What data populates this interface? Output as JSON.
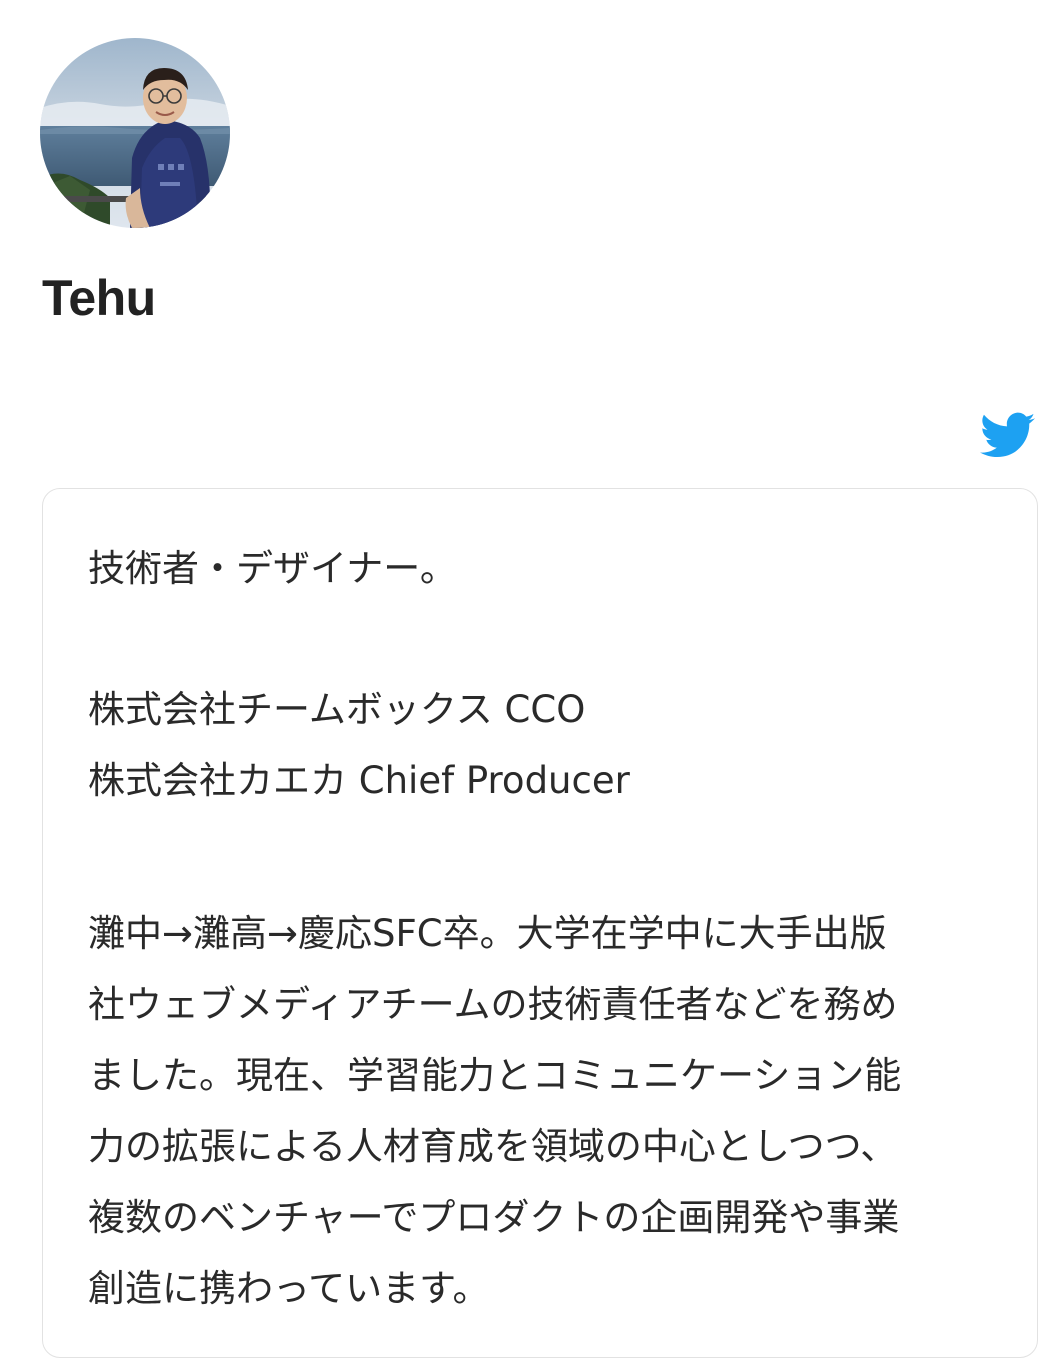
{
  "profile": {
    "name": "Tehu",
    "avatar_alt": "profile photo"
  },
  "social": {
    "twitter_icon": "twitter-bird-icon",
    "twitter_color": "#1DA1F2"
  },
  "bio": {
    "line1": "技術者・デザイナー。",
    "roles": [
      "株式会社チームボックス CCO",
      "株式会社カエカ Chief Producer"
    ],
    "history": [
      "灘中→灘高→慶応SFC卒。大学在学中に大手出版",
      "社ウェブメディアチームの技術責任者などを務め",
      "ました。現在、学習能力とコミュニケーション能",
      "力の拡張による人材育成を領域の中心としつつ、",
      "複数のベンチャーでプロダクトの企画開発や事業",
      "創造に携わっています。"
    ]
  }
}
